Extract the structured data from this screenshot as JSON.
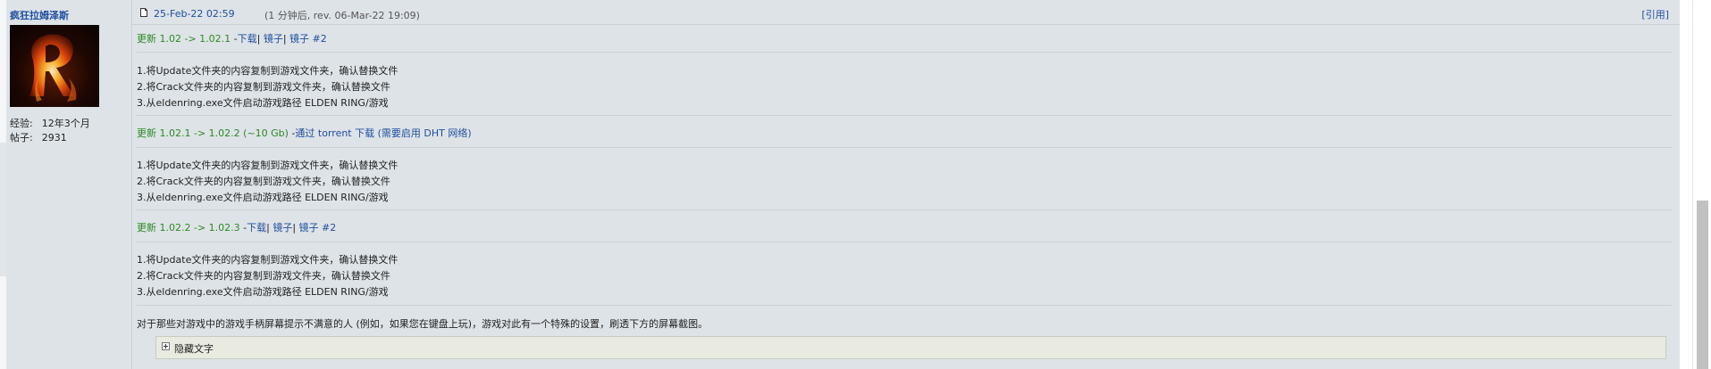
{
  "poster": {
    "username": "疯狂拉姆泽斯",
    "avatar_letter": "R",
    "stats": [
      {
        "label": "经验:",
        "value": "12年3个月"
      },
      {
        "label": "帖子:",
        "value": "2931"
      }
    ]
  },
  "post_header": {
    "icon": "post-icon",
    "date": "25-Feb-22 02:59",
    "meta": "(1 分钟后, rev. 06-Mar-22 19:09)",
    "quote_label": "[引用]"
  },
  "updates": [
    {
      "title": "更新 1.02 -> 1.02.1",
      "links": [
        {
          "prefix": " -",
          "text": "下载",
          "suffix": "| "
        },
        {
          "prefix": "",
          "text": "镜子",
          "suffix": "| "
        },
        {
          "prefix": "",
          "text": "镜子 #2",
          "suffix": ""
        }
      ],
      "steps": [
        "1.将Update文件夹的内容复制到游戏文件夹，确认替换文件",
        "2.将Crack文件夹的内容复制到游戏文件夹，确认替换文件",
        "3.从eldenring.exe文件启动游戏路径 ELDEN RING/游戏"
      ]
    },
    {
      "title": "更新 1.02.1 -> 1.02.2 (~10 Gb)",
      "links": [
        {
          "prefix": " -",
          "text": "通过 torrent 下载 (需要启用 DHT 网络)",
          "suffix": ""
        }
      ],
      "steps": [
        "1.将Update文件夹的内容复制到游戏文件夹，确认替换文件",
        "2.将Crack文件夹的内容复制到游戏文件夹，确认替换文件",
        "3.从eldenring.exe文件启动游戏路径 ELDEN RING/游戏"
      ]
    },
    {
      "title": "更新 1.02.2 -> 1.02.3",
      "links": [
        {
          "prefix": " -",
          "text": "下载",
          "suffix": "| "
        },
        {
          "prefix": "",
          "text": "镜子",
          "suffix": "| "
        },
        {
          "prefix": "",
          "text": "镜子 #2",
          "suffix": ""
        }
      ],
      "steps": [
        "1.将Update文件夹的内容复制到游戏文件夹，确认替换文件",
        "2.将Crack文件夹的内容复制到游戏文件夹，确认替换文件",
        "3.从eldenring.exe文件启动游戏路径 ELDEN RING/游戏"
      ]
    }
  ],
  "note": "对于那些对游戏中的游戏手柄屏幕提示不满意的人 (例如，如果您在键盘上玩)，游戏对此有一个特殊的设置，刷透下方的屏幕截图。",
  "spoiler": {
    "label": "隐藏文字"
  },
  "colors": {
    "post_bg": "#dee3e7",
    "link_blue": "#1f4fa0",
    "update_green": "#2a8a22",
    "spoiler_bg": "#e9ebe0"
  }
}
